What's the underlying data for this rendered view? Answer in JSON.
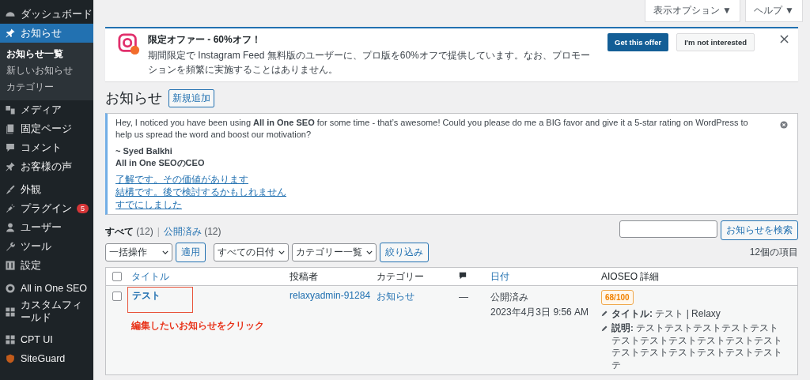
{
  "sidebar": {
    "items": [
      {
        "label": "ダッシュボード",
        "selected": false
      },
      {
        "label": "お知らせ",
        "selected": true,
        "children": [
          {
            "label": "お知らせ一覧",
            "selected": true
          },
          {
            "label": "新しいお知らせ",
            "selected": false
          },
          {
            "label": "カテゴリー",
            "selected": false
          }
        ]
      },
      {
        "label": "メディア",
        "selected": false
      },
      {
        "label": "固定ページ",
        "selected": false
      },
      {
        "label": "コメント",
        "selected": false
      },
      {
        "label": "お客様の声",
        "selected": false
      },
      {
        "label": "外観",
        "selected": false
      },
      {
        "label": "プラグイン",
        "selected": false,
        "badge": "5"
      },
      {
        "label": "ユーザー",
        "selected": false
      },
      {
        "label": "ツール",
        "selected": false
      },
      {
        "label": "設定",
        "selected": false
      },
      {
        "label": "All in One SEO",
        "selected": false
      },
      {
        "label": "カスタムフィールド",
        "selected": false
      },
      {
        "label": "CPT UI",
        "selected": false
      },
      {
        "label": "SiteGuard",
        "selected": false
      }
    ]
  },
  "top_buttons": [
    "表示オプション ▼",
    "ヘルプ ▼"
  ],
  "offer_notice": {
    "title": "限定オファー - 60%オフ！",
    "message": "期間限定で Instagram Feed 無料版のユーザーに、プロ版を60%オフで提供しています。なお、プロモーションを頻繁に実施することはありません。",
    "primary_button": "Get this offer",
    "secondary_button": "I'm not interested"
  },
  "page_title": "お知らせ",
  "add_new_button": "新規追加",
  "review_notice": {
    "message": "Hey, I noticed you have been using **All in One SEO** for some time - that’s awesome! Could you please do me a BIG favor and give it a 5-star rating on WordPress to help us spread the word and boost our motivation?",
    "signature": [
      "~ Syed Balkhi",
      "All in One SEOのCEO"
    ],
    "links": [
      "了解です。その価値があります",
      "結構です。後で検討するかもしれません",
      "すでにしました"
    ]
  },
  "filter_separator": "|",
  "filters": [
    {
      "label": "すべて",
      "count": "(12)",
      "selected": true
    },
    {
      "label": "公開済み",
      "count": "(12)",
      "selected": false
    }
  ],
  "search_button": "お知らせを検索",
  "bulk_action": "一括操作",
  "apply_button": "適用",
  "date_filter": "すべての日付",
  "category_filter": "カテゴリー一覧",
  "filter_button": "絞り込み",
  "item_count": "12個の項目",
  "table": {
    "select_all_checked": false,
    "columns": [
      "タイトル",
      "投稿者",
      "カテゴリー",
      "",
      "日付",
      "AIOSEO 詳細"
    ],
    "rows": [
      {
        "title": "テスト",
        "author": "relaxyadmin-91284",
        "category": "お知らせ",
        "comments": "—",
        "status": "公開済み",
        "date": "2023年4月3日 9:56 AM",
        "score": "68/100",
        "seo_title": "**タイトル:** テスト | Relaxy",
        "seo_description": "**説明:** テストテストテストテストテストテストテストテストテストテストテストテストテストテストテストテストテストテ",
        "checked": false,
        "highlighted": true
      }
    ]
  },
  "annotation": "編集したいお知らせをクリック"
}
